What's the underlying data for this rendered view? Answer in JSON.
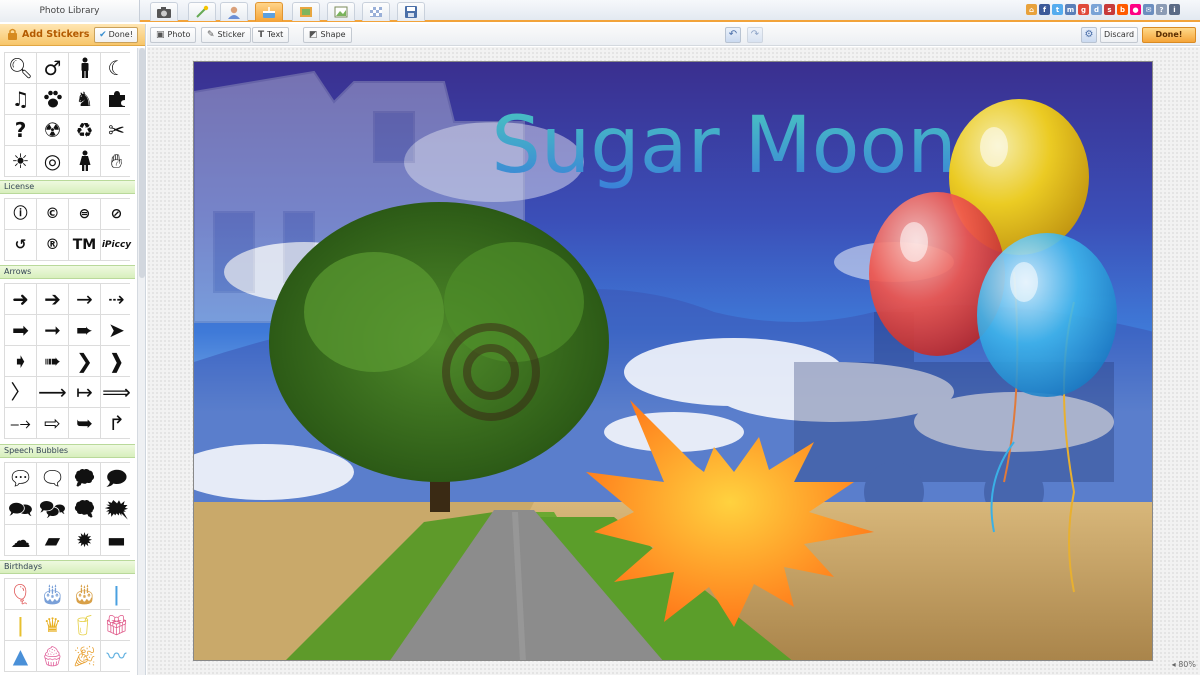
{
  "app": {
    "library_tab": "Photo Library",
    "tabs": [
      {
        "name": "camera-tab",
        "icon": "camera-icon"
      },
      {
        "name": "effects-tab",
        "icon": "magic-wand-icon"
      },
      {
        "name": "portrait-tab",
        "icon": "portrait-icon"
      },
      {
        "name": "decorate-tab",
        "icon": "cake-icon"
      },
      {
        "name": "frames-tab",
        "icon": "frame-icon"
      },
      {
        "name": "canvas-tab",
        "icon": "picture-icon"
      },
      {
        "name": "texture-tab",
        "icon": "texture-icon"
      },
      {
        "name": "save-tab",
        "icon": "save-icon"
      }
    ],
    "active_tab": "decorate-tab",
    "accent_color": "#f5a53a"
  },
  "panel": {
    "title": "Add Stickers",
    "done_label": "Done!",
    "sections": {
      "license": "License",
      "arrows": "Arrows",
      "speech": "Speech Bubbles",
      "birthdays": "Birthdays"
    },
    "license_text": {
      "tm": "TM",
      "brand": "iPiccy"
    }
  },
  "toolbar": {
    "photo": "Photo",
    "sticker": "Sticker",
    "text": "Text",
    "shape": "Shape",
    "discard": "Discard",
    "done": "Done!"
  },
  "canvas": {
    "title_text": "Sugar Moon",
    "zoom": "80%",
    "title_gradient": [
      "#49c7c0",
      "#3a7fd9"
    ],
    "burst_colors": [
      "#ffd23f",
      "#ff7a1a"
    ],
    "balloon_colors": [
      "#f4d21c",
      "#f0564d",
      "#3fb6ec"
    ]
  }
}
